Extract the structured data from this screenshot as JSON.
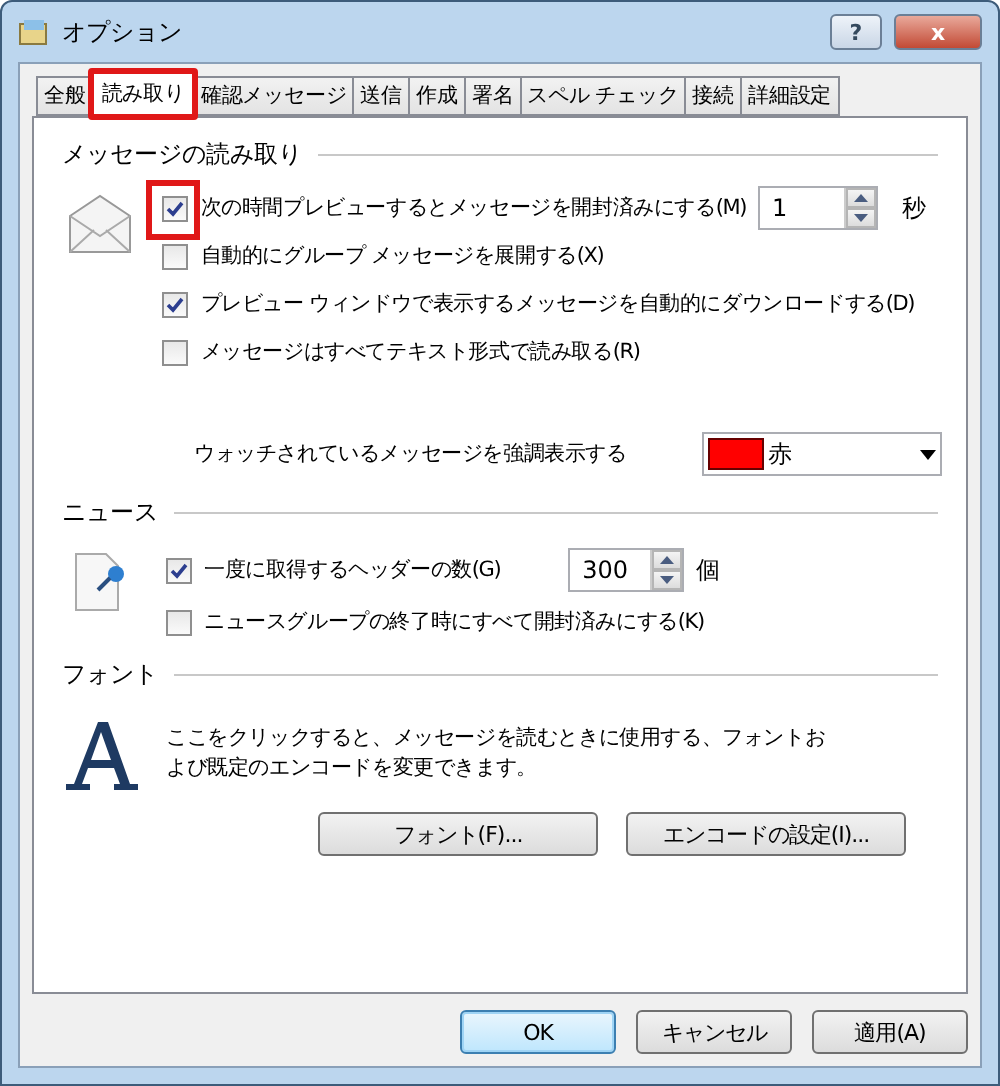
{
  "window": {
    "title": "オプション",
    "buttons": [
      {
        "kind": "help",
        "label": "?"
      },
      {
        "kind": "close",
        "label": "x"
      }
    ]
  },
  "tabs": [
    {
      "label": "全般",
      "selected": false
    },
    {
      "label": "読み取り",
      "selected": true,
      "highlighted": true
    },
    {
      "label": "確認メッセージ",
      "selected": false
    },
    {
      "label": "送信",
      "selected": false
    },
    {
      "label": "作成",
      "selected": false
    },
    {
      "label": "署名",
      "selected": false
    },
    {
      "label": "スペル チェック",
      "selected": false
    },
    {
      "label": "接続",
      "selected": false
    },
    {
      "label": "詳細設定",
      "selected": false
    }
  ],
  "reading": {
    "title": "メッセージの読み取り",
    "options": [
      {
        "label": "次の時間プレビューするとメッセージを開封済みにする(M)",
        "checked": true,
        "highlighted": true,
        "spinner": {
          "value": "1",
          "unit": "秒"
        }
      },
      {
        "label": "自動的にグループ メッセージを展開する(X)",
        "checked": false
      },
      {
        "label": "プレビュー ウィンドウで表示するメッセージを自動的にダウンロードする(D)",
        "checked": true
      },
      {
        "label": "メッセージはすべてテキスト形式で読み取る(R)",
        "checked": false
      }
    ],
    "watch": {
      "label": "ウォッチされているメッセージを強調表示する",
      "value": "赤",
      "color": "#ff0000"
    }
  },
  "news": {
    "title": "ニュース",
    "options": [
      {
        "label": "一度に取得するヘッダーの数(G)",
        "checked": true,
        "spinner": {
          "value": "300",
          "unit": "個"
        }
      },
      {
        "label": "ニュースグループの終了時にすべて開封済みにする(K)",
        "checked": false
      }
    ]
  },
  "fonts": {
    "title": "フォント",
    "description": "ここをクリックすると、メッセージを読むときに使用する、フォントおよび既定のエンコードを変更できます。",
    "buttons": [
      "フォント(F)...",
      "エンコードの設定(I)..."
    ]
  },
  "footer": [
    {
      "label": "OK",
      "default": true
    },
    {
      "label": "キャンセル",
      "default": false
    },
    {
      "label": "適用(A)",
      "default": false
    }
  ]
}
